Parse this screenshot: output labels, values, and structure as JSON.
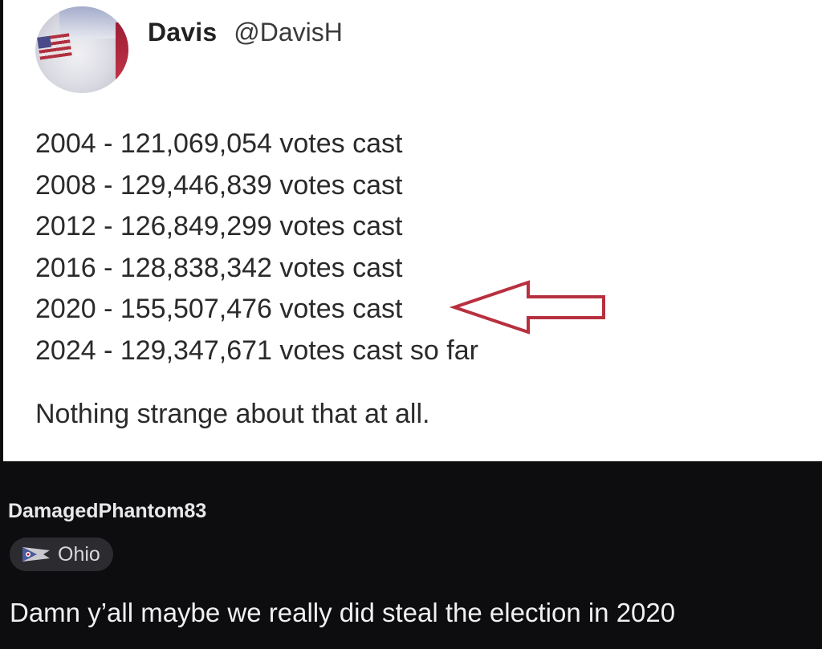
{
  "post": {
    "author_name": "Davis",
    "author_handle": "@DavisH",
    "lines": [
      "2004 - 121,069,054 votes cast",
      "2008 - 129,446,839 votes cast",
      "2012 - 126,849,299 votes cast",
      "2016 - 128,838,342 votes cast",
      "2020 - 155,507,476 votes cast",
      "2024 - 129,347,671 votes cast so far"
    ],
    "closing": "Nothing strange about that at all.",
    "arrow_color": "#b8303f",
    "arrow_icon": "left-arrow-icon"
  },
  "comment": {
    "username": "DamagedPhantom83",
    "flair_label": "Ohio",
    "flair_icon": "ohio-flag-icon",
    "text": "Damn y’all maybe we really did steal the election in 2020"
  }
}
